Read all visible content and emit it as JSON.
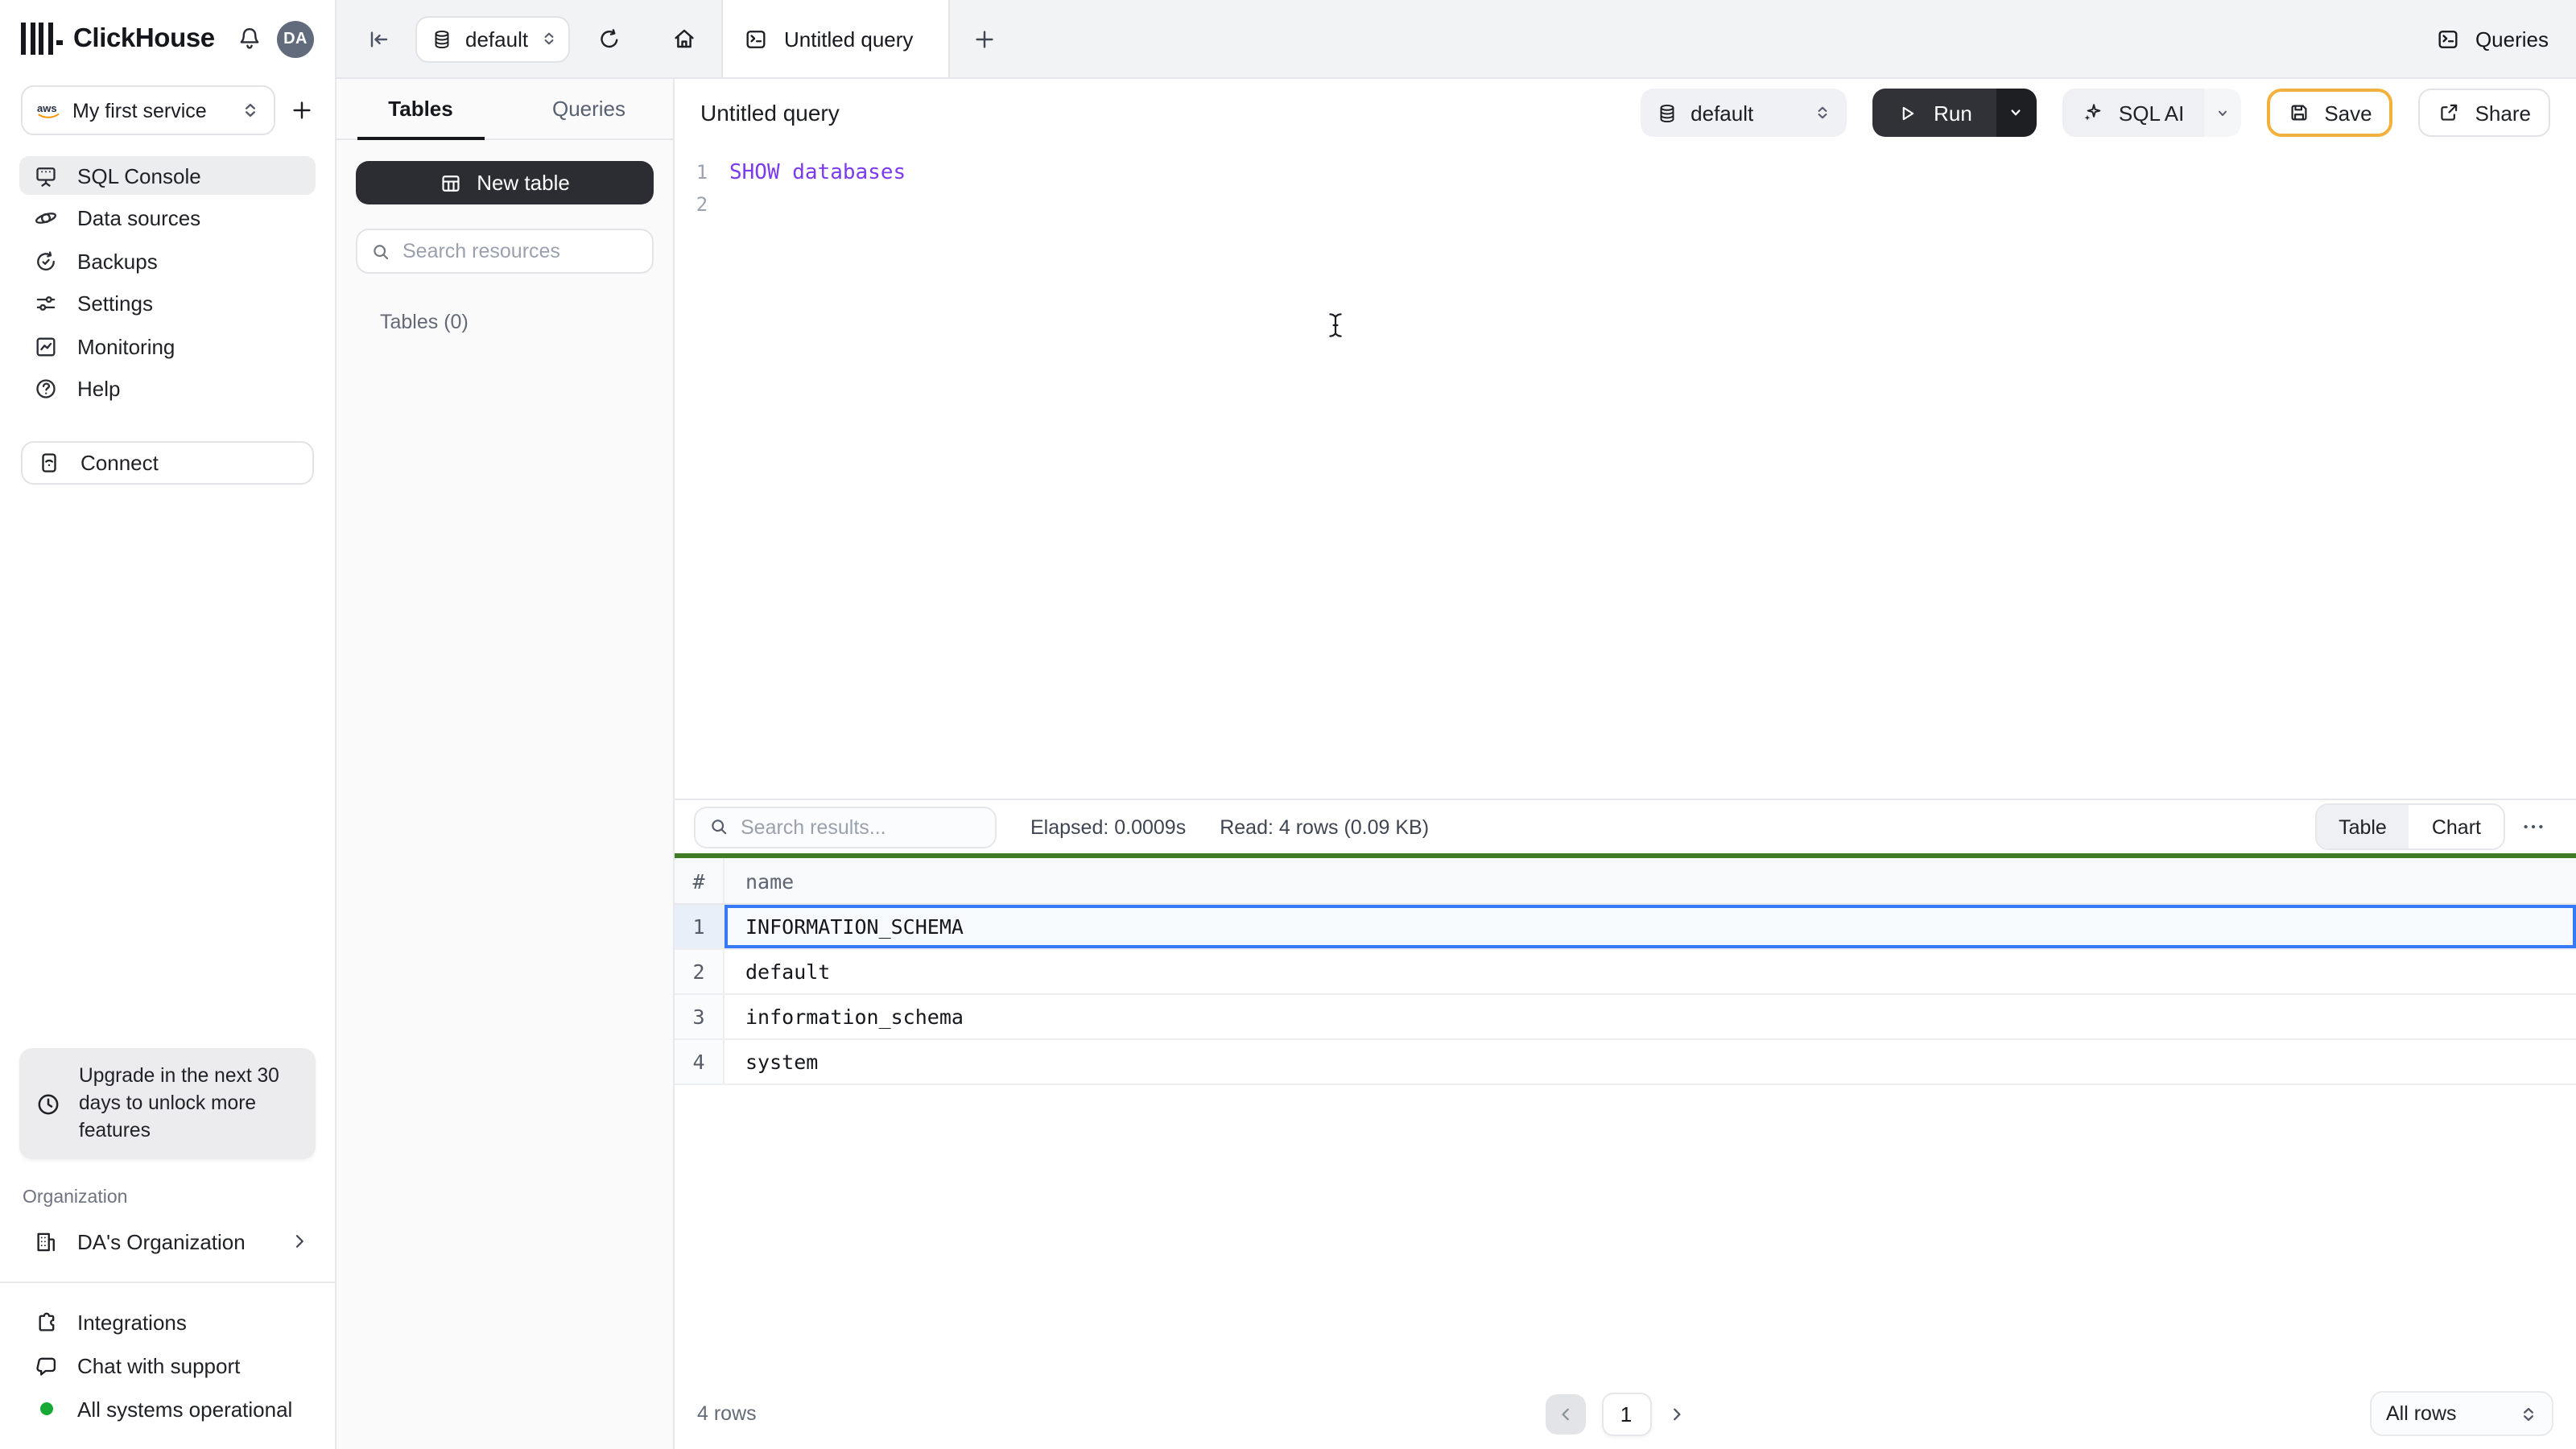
{
  "header": {
    "app_name": "ClickHouse",
    "avatar_initials": "DA"
  },
  "sidebar": {
    "service_selector": {
      "label": "My first service"
    },
    "nav_items": [
      {
        "label": "SQL Console",
        "selected": true
      },
      {
        "label": "Data sources",
        "selected": false
      },
      {
        "label": "Backups",
        "selected": false
      },
      {
        "label": "Settings",
        "selected": false
      },
      {
        "label": "Monitoring",
        "selected": false
      },
      {
        "label": "Help",
        "selected": false
      }
    ],
    "connect_label": "Connect",
    "upgrade_notice": "Upgrade in the next 30 days to unlock more features",
    "organization": {
      "section_label": "Organization",
      "name": "DA's Organization"
    },
    "footer_items": [
      "Integrations",
      "Chat with support",
      "All systems operational"
    ]
  },
  "tabstrip": {
    "database_selector": "default",
    "active_tab": "Untitled query",
    "queries_button": "Queries"
  },
  "explorer": {
    "tabs": [
      {
        "label": "Tables"
      },
      {
        "label": "Queries"
      }
    ],
    "new_table_button": "New table",
    "search_placeholder": "Search resources",
    "section_label": "Tables (0)"
  },
  "query_editor": {
    "title": "Untitled query",
    "database_selector": "default",
    "run_button": "Run",
    "sql_ai_button": "SQL AI",
    "save_button": "Save",
    "share_button": "Share",
    "lines": [
      {
        "number": "1",
        "code": "SHOW databases"
      },
      {
        "number": "2",
        "code": ""
      }
    ]
  },
  "results": {
    "search_placeholder": "Search results...",
    "elapsed": "Elapsed: 0.0009s",
    "read": "Read: 4 rows (0.09 KB)",
    "view_toggle": [
      "Table",
      "Chart"
    ],
    "table": {
      "columns": [
        "#",
        "name"
      ],
      "rows": [
        [
          "1",
          "INFORMATION_SCHEMA"
        ],
        [
          "2",
          "default"
        ],
        [
          "3",
          "information_schema"
        ],
        [
          "4",
          "system"
        ]
      ],
      "selected_row": 1
    },
    "footer": {
      "row_count": "4 rows",
      "page": "1",
      "page_size": "All rows"
    }
  },
  "colors": {
    "accent_green": "#407c25",
    "status_green": "#16a934",
    "tab_dot_green": "#12a43a",
    "selection_blue": "#3579f6",
    "code_purple": "#7c3aed",
    "save_border_amber": "#f2b13c",
    "dark_button": "#2c2d32",
    "strip_bg": "#f2f3f5"
  }
}
